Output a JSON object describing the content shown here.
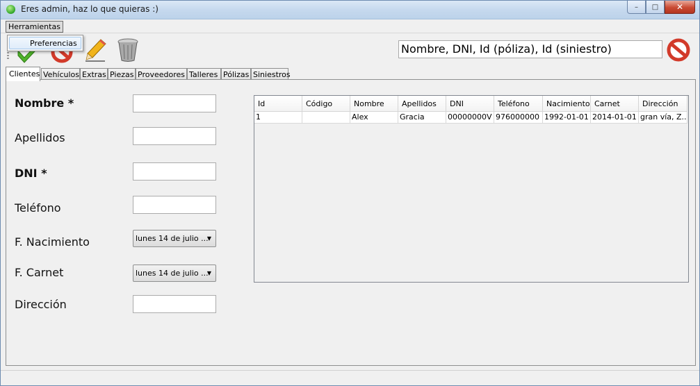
{
  "window": {
    "title": "Eres admin, haz lo que quieras :)",
    "buttons": {
      "minimize": "–",
      "maximize": "□",
      "close": "✕"
    }
  },
  "menubar": {
    "items": [
      {
        "label": "Herramientas"
      }
    ]
  },
  "menu_popup": {
    "items": [
      {
        "label": "Preferencias"
      }
    ]
  },
  "toolbar": {
    "icons": [
      "accept-icon",
      "cancel-icon",
      "edit-pencil-icon",
      "trash-icon"
    ],
    "search": {
      "value": "Nombre, DNI, Id (póliza), Id (siniestro)"
    },
    "clear_icon": "no-entry-icon"
  },
  "tabs": [
    {
      "label": "Clientes",
      "active": true
    },
    {
      "label": "Vehículos"
    },
    {
      "label": "Extras"
    },
    {
      "label": "Piezas"
    },
    {
      "label": "Proveedores"
    },
    {
      "label": "Talleres"
    },
    {
      "label": "Pólizas"
    },
    {
      "label": "Siniestros"
    }
  ],
  "form": {
    "fields": [
      {
        "label": "Nombre *",
        "value": ""
      },
      {
        "label": "Apellidos",
        "value": ""
      },
      {
        "label": "DNI *",
        "value": ""
      },
      {
        "label": "Teléfono",
        "value": ""
      },
      {
        "label": "F. Nacimiento",
        "value": "lunes 14 de julio ..."
      },
      {
        "label": "F. Carnet",
        "value": "lunes 14 de julio ..."
      },
      {
        "label": "Dirección",
        "value": ""
      }
    ]
  },
  "table": {
    "columns": [
      "Id",
      "Código",
      "Nombre",
      "Apellidos",
      "DNI",
      "Teléfono",
      "Nacimiento",
      "Carnet",
      "Dirección"
    ],
    "rows": [
      [
        "1",
        "",
        "Alex",
        "Gracia",
        "00000000V",
        "976000000",
        "1992-01-01",
        "2014-01-01",
        "gran vía, Z..."
      ]
    ]
  },
  "colors": {
    "accept_green": "#4fb22a",
    "cancel_red": "#d23a2a",
    "titlebar": "#c6d9ee"
  }
}
